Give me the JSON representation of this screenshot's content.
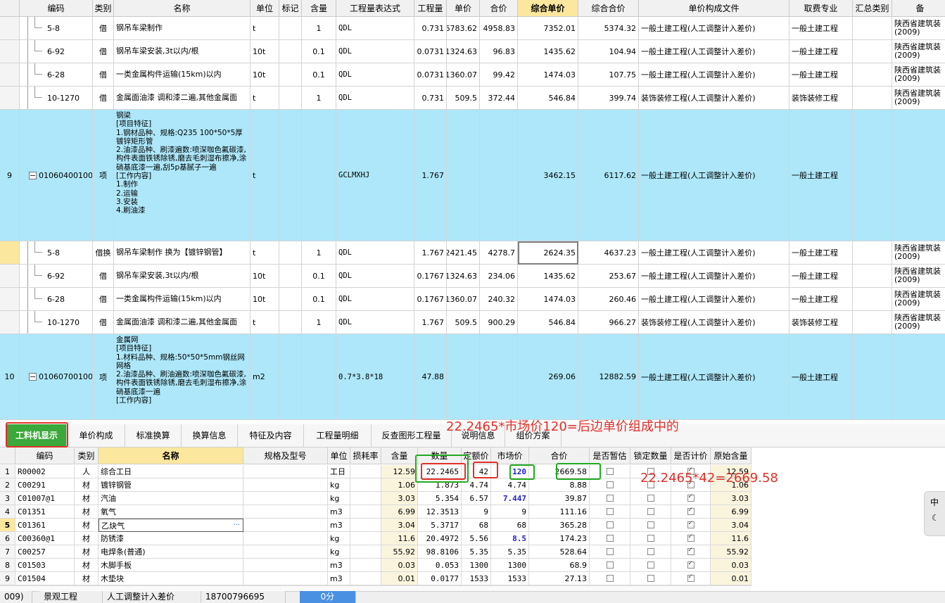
{
  "grid": {
    "headers": [
      "编码",
      "类别",
      "名称",
      "单位",
      "标记",
      "含量",
      "工程量表达式",
      "工程量",
      "单价",
      "合价",
      "综合单价",
      "综合合价",
      "单价构成文件",
      "取费专业",
      "汇总类别",
      "备"
    ],
    "rows": [
      {
        "num": "",
        "code": "5-8",
        "type": "借",
        "name": "钢吊车梁制作",
        "unit": "t",
        "qty_ratio": "1",
        "expr": "QDL",
        "amount": "0.731",
        "price": "6783.62",
        "total": "4958.83",
        "comp_price": "7352.01",
        "comp_total": "5374.32",
        "file": "一般土建工程(人工调整计入差价)",
        "fee": "一般土建工程",
        "sum": "",
        "note": "陕西省建筑装\n(2009)"
      },
      {
        "num": "",
        "code": "6-92",
        "type": "借",
        "name": "钢吊车梁安装,3t以内/根",
        "unit": "10t",
        "qty_ratio": "0.1",
        "expr": "QDL",
        "amount": "0.0731",
        "price": "1324.63",
        "total": "96.83",
        "comp_price": "1435.62",
        "comp_total": "104.94",
        "file": "一般土建工程(人工调整计入差价)",
        "fee": "一般土建工程",
        "sum": "",
        "note": "陕西省建筑装\n(2009)"
      },
      {
        "num": "",
        "code": "6-28",
        "type": "借",
        "name": "一类金属构件运输(15km)以内",
        "unit": "10t",
        "qty_ratio": "0.1",
        "expr": "QDL",
        "amount": "0.0731",
        "price": "1360.07",
        "total": "99.42",
        "comp_price": "1474.03",
        "comp_total": "107.75",
        "file": "一般土建工程(人工调整计入差价)",
        "fee": "一般土建工程",
        "sum": "",
        "note": "陕西省建筑装\n(2009)"
      },
      {
        "num": "",
        "code": "10-1270",
        "type": "借",
        "name": "金属面油漆 调和漆二遍,其他金属面",
        "unit": "t",
        "qty_ratio": "1",
        "expr": "QDL",
        "amount": "0.731",
        "price": "509.5",
        "total": "372.44",
        "comp_price": "546.84",
        "comp_total": "399.74",
        "file": "装饰装修工程(人工调整计入差价)",
        "fee": "装饰装修工程",
        "sum": "",
        "note": "陕西省建筑装\n(2009)"
      },
      {
        "num": "9",
        "code": "010604001002",
        "type": "项",
        "name": "钢梁\n[项目特征]\n1.钢材品种、规格:Q235 100*50*5厚镀锌矩形管\n2.油漆品种、刷漆遍数:喷深咖色氟碳漆,构件表面铁锈除锈,磨去毛刺湿布擦净,涂硝基底漆一遍,刮5p基腻子一遍\n[工作内容]\n1.制作\n2.运输\n3.安装\n4.刷油漆",
        "unit": "t",
        "qty_ratio": "",
        "expr": "GCLMXHJ",
        "amount": "1.767",
        "price": "",
        "total": "",
        "comp_price": "3462.15",
        "comp_total": "6117.62",
        "file": "一般土建工程(人工调整计入差价)",
        "fee": "一般土建工程",
        "sum": "",
        "note": ""
      },
      {
        "num": "",
        "code": "5-8",
        "type": "借换",
        "name": "钢吊车梁制作  换为【镀锌钢管】",
        "unit": "t",
        "qty_ratio": "1",
        "expr": "QDL",
        "amount": "1.767",
        "price": "2421.45",
        "total": "4278.7",
        "comp_price": "2624.35",
        "comp_total": "4637.23",
        "file": "一般土建工程(人工调整计入差价)",
        "fee": "一般土建工程",
        "sum": "",
        "note": "陕西省建筑装\n(2009)"
      },
      {
        "num": "",
        "code": "6-92",
        "type": "借",
        "name": "钢吊车梁安装,3t以内/根",
        "unit": "10t",
        "qty_ratio": "0.1",
        "expr": "QDL",
        "amount": "0.1767",
        "price": "1324.63",
        "total": "234.06",
        "comp_price": "1435.62",
        "comp_total": "253.67",
        "file": "一般土建工程(人工调整计入差价)",
        "fee": "一般土建工程",
        "sum": "",
        "note": "陕西省建筑装\n(2009)"
      },
      {
        "num": "",
        "code": "6-28",
        "type": "借",
        "name": "一类金属构件运输(15km)以内",
        "unit": "10t",
        "qty_ratio": "0.1",
        "expr": "QDL",
        "amount": "0.1767",
        "price": "1360.07",
        "total": "240.32",
        "comp_price": "1474.03",
        "comp_total": "260.46",
        "file": "一般土建工程(人工调整计入差价)",
        "fee": "一般土建工程",
        "sum": "",
        "note": "陕西省建筑装\n(2009)"
      },
      {
        "num": "",
        "code": "10-1270",
        "type": "借",
        "name": "金属面油漆 调和漆二遍,其他金属面",
        "unit": "t",
        "qty_ratio": "1",
        "expr": "QDL",
        "amount": "1.767",
        "price": "509.5",
        "total": "900.29",
        "comp_price": "546.84",
        "comp_total": "966.27",
        "file": "装饰装修工程(人工调整计入差价)",
        "fee": "装饰装修工程",
        "sum": "",
        "note": "陕西省建筑装\n(2009)"
      },
      {
        "num": "10",
        "code": "010607001001",
        "type": "项",
        "name": "金属网\n[项目特征]\n1.材料品种、规格:50*50*5mm钢丝网网格\n2.油漆品种、刷油遍数:喷深咖色氟碳漆,构件表面铁锈除锈,磨去毛刺湿布擦净,涂硝基底漆一遍\n[工作内容]",
        "unit": "m2",
        "qty_ratio": "",
        "expr": "0.7*3.8*18",
        "amount": "47.88",
        "price": "",
        "total": "",
        "comp_price": "269.06",
        "comp_total": "12882.59",
        "file": "一般土建工程(人工调整计入差价)",
        "fee": "一般土建工程",
        "sum": "",
        "note": ""
      }
    ]
  },
  "tabs": [
    "工料机显示",
    "单价构成",
    "标准换算",
    "换算信息",
    "特征及内容",
    "工程量明细",
    "反查图形工程量",
    "说明信息",
    "组价方案"
  ],
  "bottom": {
    "headers": [
      "编码",
      "类别",
      "名称",
      "规格及型号",
      "单位",
      "损耗率",
      "含量",
      "数量",
      "定额价",
      "市场价",
      "合价",
      "是否暂估",
      "锁定数量",
      "是否计价",
      "原始含量"
    ],
    "rows": [
      {
        "num": "1",
        "code": "R00002",
        "type": "人",
        "name": "综合工日",
        "spec": "",
        "unit": "工日",
        "loss": "",
        "ratio": "12.59",
        "qty": "22.2465",
        "quota": "42",
        "market": "120",
        "total": "2669.58",
        "orig": "12.59",
        "blue": true,
        "temp": false,
        "lock": false,
        "priced": true
      },
      {
        "num": "2",
        "code": "C00291",
        "type": "材",
        "name": "镀锌钢管",
        "spec": "",
        "unit": "kg",
        "loss": "",
        "ratio": "1.06",
        "qty": "1.873",
        "quota": "4.74",
        "market": "4.74",
        "total": "8.88",
        "orig": "1.06",
        "blue": false,
        "temp": false,
        "lock": false,
        "priced": true
      },
      {
        "num": "3",
        "code": "C01007@1",
        "type": "材",
        "name": "汽油",
        "spec": "",
        "unit": "kg",
        "loss": "",
        "ratio": "3.03",
        "qty": "5.354",
        "quota": "6.57",
        "market": "7.447",
        "total": "39.87",
        "orig": "3.03",
        "blue": true,
        "temp": false,
        "lock": false,
        "priced": true
      },
      {
        "num": "4",
        "code": "C01351",
        "type": "材",
        "name": "氧气",
        "spec": "",
        "unit": "m3",
        "loss": "",
        "ratio": "6.99",
        "qty": "12.3513",
        "quota": "9",
        "market": "9",
        "total": "111.16",
        "orig": "6.99",
        "blue": false,
        "temp": false,
        "lock": false,
        "priced": true
      },
      {
        "num": "5",
        "code": "C01361",
        "type": "材",
        "name": "乙炔气",
        "spec": "",
        "unit": "m3",
        "loss": "",
        "ratio": "3.04",
        "qty": "5.3717",
        "quota": "68",
        "market": "68",
        "total": "365.28",
        "orig": "3.04",
        "blue": false,
        "temp": false,
        "lock": false,
        "priced": true
      },
      {
        "num": "6",
        "code": "C00360@1",
        "type": "材",
        "name": "防锈漆",
        "spec": "",
        "unit": "kg",
        "loss": "",
        "ratio": "11.6",
        "qty": "20.4972",
        "quota": "5.56",
        "market": "8.5",
        "total": "174.23",
        "orig": "11.6",
        "blue": true,
        "temp": false,
        "lock": false,
        "priced": true
      },
      {
        "num": "7",
        "code": "C00257",
        "type": "材",
        "name": "电焊条(普通)",
        "spec": "",
        "unit": "kg",
        "loss": "",
        "ratio": "55.92",
        "qty": "98.8106",
        "quota": "5.35",
        "market": "5.35",
        "total": "528.64",
        "orig": "55.92",
        "blue": false,
        "temp": false,
        "lock": false,
        "priced": true
      },
      {
        "num": "8",
        "code": "C01503",
        "type": "材",
        "name": "木脚手板",
        "spec": "",
        "unit": "m3",
        "loss": "",
        "ratio": "0.03",
        "qty": "0.053",
        "quota": "1300",
        "market": "1300",
        "total": "68.9",
        "orig": "0.03",
        "blue": false,
        "temp": false,
        "lock": false,
        "priced": true
      },
      {
        "num": "9",
        "code": "C01504",
        "type": "材",
        "name": "木垫块",
        "spec": "",
        "unit": "m3",
        "loss": "",
        "ratio": "0.01",
        "qty": "0.0177",
        "quota": "1533",
        "market": "1533",
        "total": "27.13",
        "orig": "0.01",
        "blue": false,
        "temp": false,
        "lock": false,
        "priced": true
      }
    ]
  },
  "annotations": {
    "top": "22.2465*市场价120=后边单价组成中的",
    "right": "22.2465*42=2669.58"
  },
  "status": [
    "009)",
    "景观工程",
    "人工调整计入差价",
    "18700796695",
    "0分"
  ],
  "side_widget": {
    "label": "中",
    "icon": "moon-icon"
  },
  "colors": {
    "accent": "#3aa83a",
    "row_highlight": "#ade7f9",
    "header_highlight": "#fbe79d",
    "annot_red": "#e0302a",
    "annot_green": "#22aa22",
    "market_blue": "#1f1fd0"
  }
}
